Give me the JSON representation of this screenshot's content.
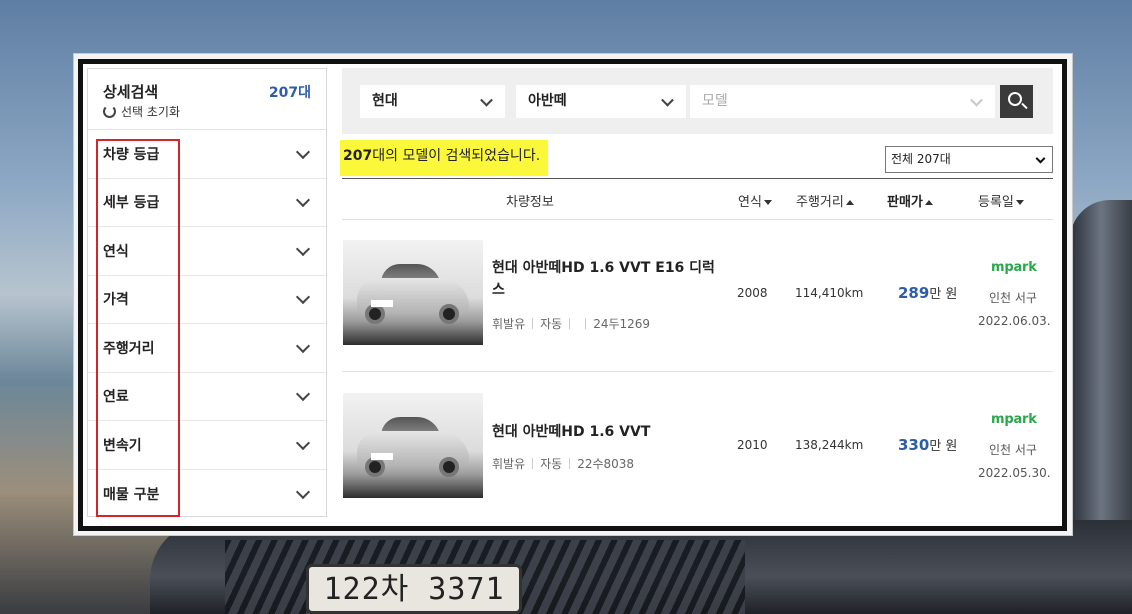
{
  "background": {
    "plate_text": "122차 3371"
  },
  "sidebar": {
    "title": "상세검색",
    "reset_label": "선택 초기화",
    "count": "207대",
    "items": [
      {
        "label": "차량 등급"
      },
      {
        "label": "세부 등급"
      },
      {
        "label": "연식"
      },
      {
        "label": "가격"
      },
      {
        "label": "주행거리"
      },
      {
        "label": "연료"
      },
      {
        "label": "변속기"
      },
      {
        "label": "매물 구분"
      }
    ]
  },
  "search": {
    "maker": "현대",
    "model_group": "아반떼",
    "model_placeholder": "모델"
  },
  "result": {
    "count": "207",
    "message": "대의 모델이 검색되었습니다.",
    "filter_selected": "전체 207대"
  },
  "table": {
    "headers": {
      "info": "차량정보",
      "year": "연식",
      "mileage": "주행거리",
      "price": "판매가",
      "date": "등록일"
    }
  },
  "cars": [
    {
      "title": "현대 아반떼HD 1.6 VVT E16 디럭스",
      "fuel": "휘발유",
      "transmission": "자동",
      "plate": "24두1269",
      "year": "2008",
      "mileage": "114,410km",
      "price": "289",
      "price_unit": "만 원",
      "dealer_brand": "mpark",
      "location": "인천 서구",
      "date": "2022.06.03."
    },
    {
      "title": "현대 아반떼HD 1.6 VVT",
      "fuel": "휘발유",
      "transmission": "자동",
      "plate": "22수8038",
      "year": "2010",
      "mileage": "138,244km",
      "price": "330",
      "price_unit": "만 원",
      "dealer_brand": "mpark",
      "location": "인천 서구",
      "date": "2022.05.30."
    }
  ],
  "colors": {
    "accent_blue": "#2e5da8",
    "highlight_yellow": "#fbf73b",
    "annotation_red": "#d4252b",
    "mpark_green": "#2aa84a"
  }
}
